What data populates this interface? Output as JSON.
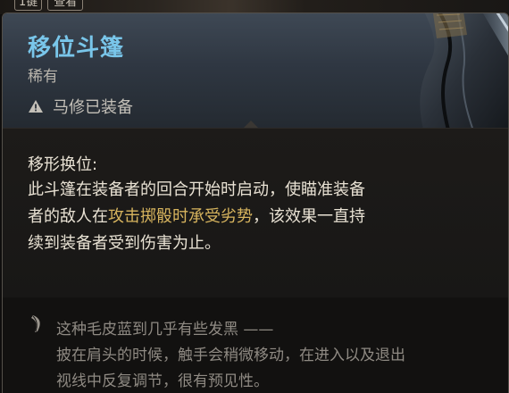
{
  "keybind": {
    "key": "1键",
    "label": "查看"
  },
  "item": {
    "name": "移位斗篷",
    "rarity": "稀有",
    "equipped_status": "马修已装备"
  },
  "ability": {
    "title": "移形换位:",
    "text_part1": "此斗篷在装备者的回合开始时启动，使瞄准装备者的敌人在",
    "text_highlight": "攻击掷骰时承受劣势",
    "text_part2": "，该效果一直持续到装备者受到伤害为止。"
  },
  "flavor": {
    "line1": "这种毛皮蓝到几乎有些发黑 ——",
    "line2": "披在肩头的时候，触手会稍微移动，在进入以及退出",
    "line3": "视线中反复调节，很有预见性。"
  },
  "colors": {
    "title": "#79c6ea",
    "highlight": "#d7b45e",
    "body_text": "#e9e2d4",
    "flavor_text": "#8f8a83"
  },
  "icons": {
    "warning": "warning-triangle-icon",
    "flavor": "feather-icon"
  }
}
